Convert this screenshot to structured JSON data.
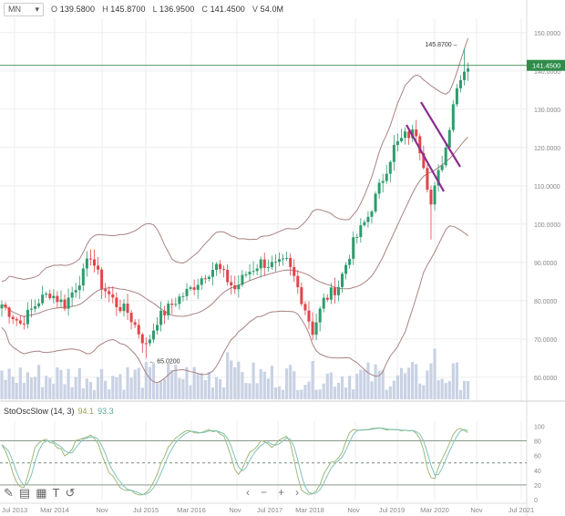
{
  "header": {
    "symbol": "MN",
    "open_label": "O",
    "open": "139.5800",
    "high_label": "H",
    "high": "145.8700",
    "low_label": "L",
    "low": "136.9500",
    "close_label": "C",
    "close": "141.4500",
    "volume_label": "V",
    "volume": "54.0M"
  },
  "oscillator": {
    "name": "StoOscSlow (14, 3)",
    "k": "94.1",
    "d": "93.3"
  },
  "toolbar": {
    "prev": "‹",
    "zoom_out": "−",
    "zoom_in": "+",
    "next": "›"
  },
  "colors": {
    "up": "#2e9c6e",
    "down": "#e0454a",
    "band": "#a98282",
    "trend": "#8b2c8f",
    "volume": "#c9d2e4",
    "k_line": "#9fb879",
    "d_line": "#7fc2b6",
    "ref_line": "#7a8a7a"
  },
  "chart_data": {
    "type": "candlestick",
    "price_axis": {
      "ticks": [
        "60.0000",
        "70.0000",
        "80.0000",
        "90.0000",
        "100.0000",
        "110.0000",
        "120.0000",
        "130.0000",
        "140.0000",
        "150.0000"
      ],
      "range": [
        54,
        154
      ]
    },
    "time_axis": {
      "labels": [
        "Jul 2013",
        "Mar 2014",
        "Nov",
        "Jul 2015",
        "Mar 2016",
        "Nov",
        "Jul 2017",
        "Mar 2018",
        "Nov",
        "Jul 2019",
        "Mar 2020",
        "Nov",
        "Jul 2021"
      ]
    },
    "last_price_label": "141.4500",
    "annotations": {
      "high": "145.8700",
      "low": "65.0200"
    },
    "osc_axis": {
      "ticks": [
        "0",
        "20",
        "40",
        "60",
        "80",
        "100"
      ],
      "levels": [
        80,
        50,
        20
      ]
    },
    "indicators": [
      "Bollinger Bands",
      "Volume",
      "StoOscSlow (14, 3)"
    ]
  }
}
